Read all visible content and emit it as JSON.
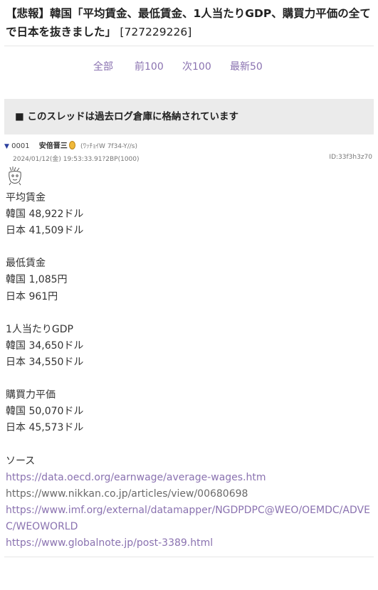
{
  "thread": {
    "title": "【悲報】韓国「平均賃金、最低賃金、1人当たりGDP、購買力平価の全てで日本を抜きました」",
    "id": "[727229226]"
  },
  "nav": {
    "all": "全部",
    "prev": "前100",
    "next": "次100",
    "latest": "最新50"
  },
  "archive_notice": "■ このスレッドは過去ログ倉庫に格納されています",
  "post": {
    "triangle": "▼",
    "number": "0001",
    "name": "安倍晋三",
    "trip": "(ﾜｯﾁｮｲW 7f34-Y//s)",
    "datetime": "2024/01/12(金) 19:53:33.91?2BP(1000)",
    "user_id": "ID:33f3h3z70",
    "lines": [
      "平均賃金",
      "韓国 48,922ドル",
      "日本 41,509ドル",
      "",
      "最低賃金",
      "韓国 1,085円",
      "日本 961円",
      "",
      "1人当たりGDP",
      "韓国 34,650ドル",
      "日本 34,550ドル",
      "",
      "購買力平価",
      "韓国 50,070ドル",
      "日本 45,573ドル",
      "",
      "ソース"
    ],
    "links": [
      "https://data.oecd.org/earnwage/average-wages.htm",
      "https://www.nikkan.co.jp/articles/view/00680698",
      "https://www.imf.org/external/datamapper/NGDPDPC@WEO/OEMDC/ADVEC/WEOWORLD",
      "https://www.globalnote.jp/post-3389.html"
    ]
  },
  "colors": {
    "nav_link": "#8a72b0",
    "archive_bg": "#ebebeb",
    "triangle": "#2b3f9e"
  }
}
